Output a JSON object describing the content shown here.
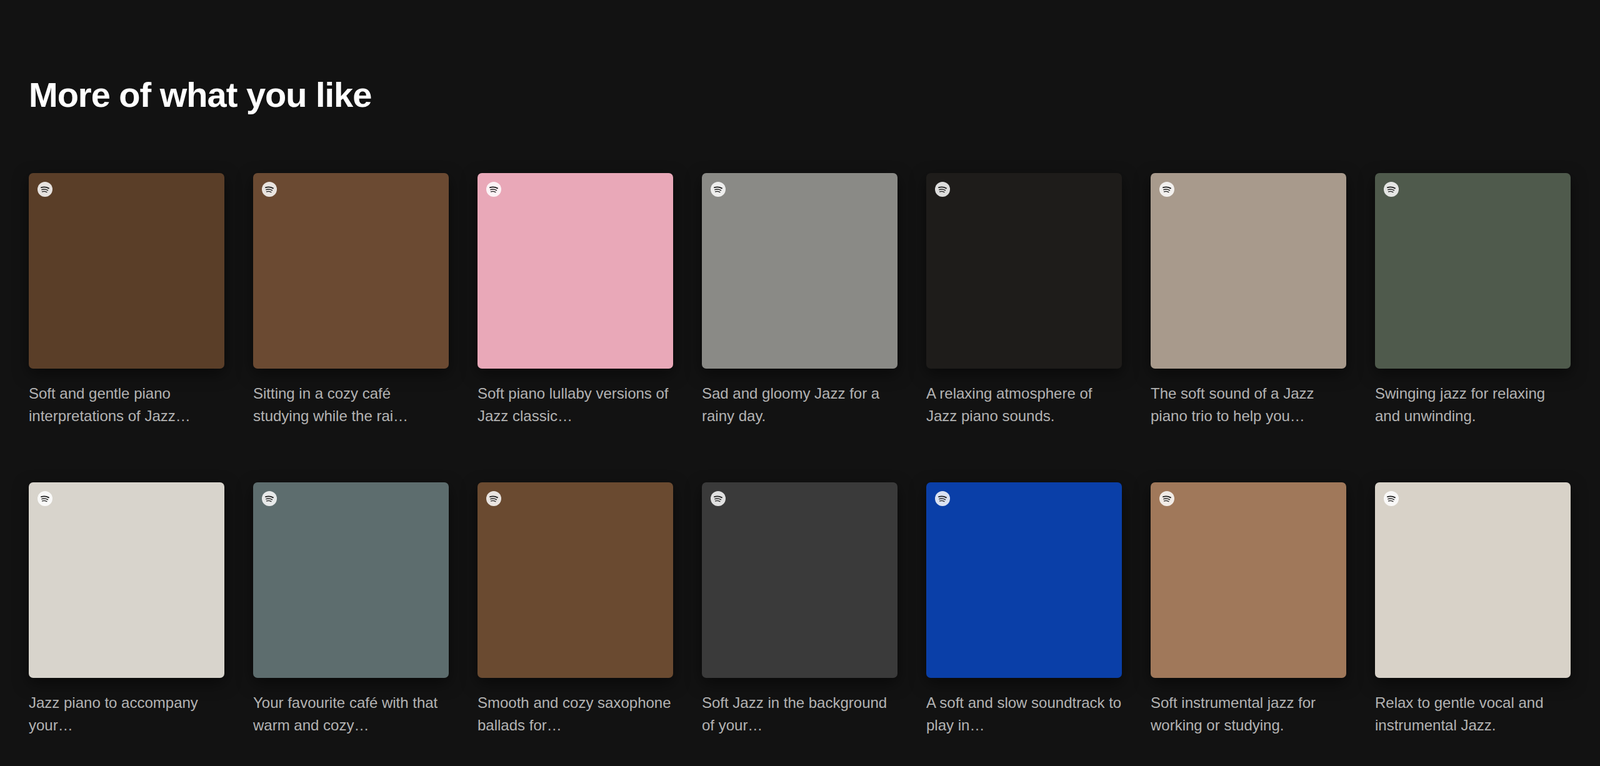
{
  "section": {
    "title": "More of what you like"
  },
  "playlists": [
    {
      "description": "Soft and gentle piano interpretations of Jazz…",
      "color": "#5a3e28"
    },
    {
      "description": "Sitting in a cozy café studying while the rai…",
      "color": "#6b4a32"
    },
    {
      "description": "Soft piano lullaby versions of Jazz classic…",
      "color": "#e9a8b8"
    },
    {
      "description": "Sad and gloomy Jazz for a rainy day.",
      "color": "#8a8a86"
    },
    {
      "description": "A relaxing atmosphere of Jazz piano sounds.",
      "color": "#1e1c1a"
    },
    {
      "description": "The soft sound of a Jazz piano trio to help you…",
      "color": "#a89a8c"
    },
    {
      "description": "Swinging jazz for relaxing and unwinding.",
      "color": "#4f5a4c"
    },
    {
      "description": "Jazz piano to accompany your…",
      "color": "#d8d4cc"
    },
    {
      "description": "Your favourite café with that warm and cozy…",
      "color": "#5d6d6e"
    },
    {
      "description": "Smooth and cozy saxophone ballads for…",
      "color": "#6a4a30"
    },
    {
      "description": "Soft Jazz in the background of your…",
      "color": "#3a3a3a"
    },
    {
      "description": "A soft and slow soundtrack to play in…",
      "color": "#0a3fa8"
    },
    {
      "description": "Soft instrumental jazz for working or studying.",
      "color": "#a0785a"
    },
    {
      "description": "Relax to gentle vocal and instrumental Jazz.",
      "color": "#d8d2c8"
    }
  ]
}
